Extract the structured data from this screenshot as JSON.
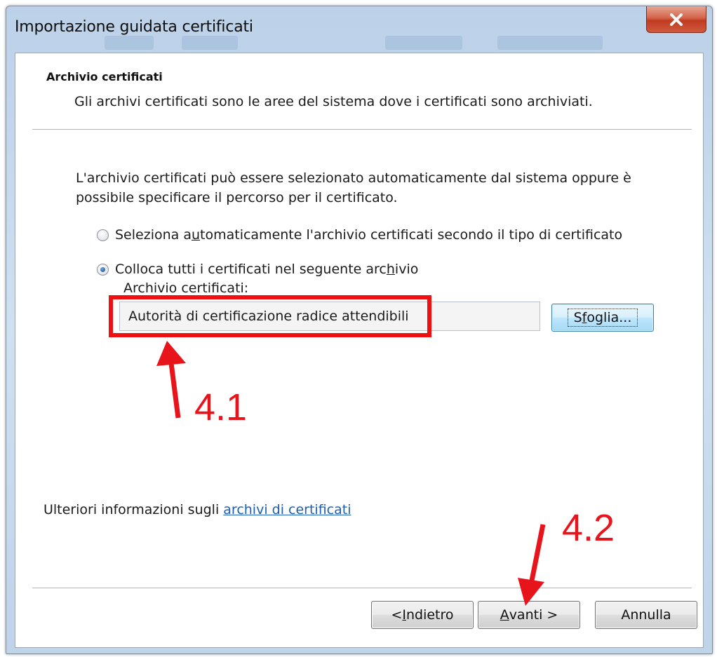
{
  "window": {
    "title": "Importazione guidata certificati"
  },
  "header": {
    "title": "Archivio certificati",
    "description": "Gli archivi certificati sono le aree del sistema dove i certificati sono archiviati."
  },
  "body": {
    "intro": "L'archivio certificati può essere selezionato automaticamente dal sistema oppure è possibile specificare il percorso per il certificato.",
    "radios": [
      {
        "pre": "Seleziona a",
        "key": "u",
        "post": "tomaticamente l'archivio certificati secondo il tipo di certificato",
        "checked": false
      },
      {
        "pre": "Colloca tutti i certificati nel seguente arc",
        "key": "h",
        "post": "ivio",
        "checked": true
      }
    ],
    "store_label": "Archivio certificati:",
    "store_value": "Autorità di certificazione radice attendibili",
    "browse": {
      "pre": "S",
      "key": "f",
      "post": "oglia..."
    }
  },
  "more_info": {
    "text": "Ulteriori informazioni sugli ",
    "link": "archivi di certificati"
  },
  "footer": {
    "back": {
      "pre": "< ",
      "key": "I",
      "post": "ndietro"
    },
    "next": {
      "pre": "",
      "key": "A",
      "post": "vanti >"
    },
    "cancel": "Annulla"
  },
  "annotations": {
    "step1": "4.1",
    "step2": "4.2",
    "color": "#e8141b"
  },
  "colors": {
    "close_button": "#c13a20",
    "link": "#1a5fb4",
    "default_button_border": "#3c7fb1"
  }
}
